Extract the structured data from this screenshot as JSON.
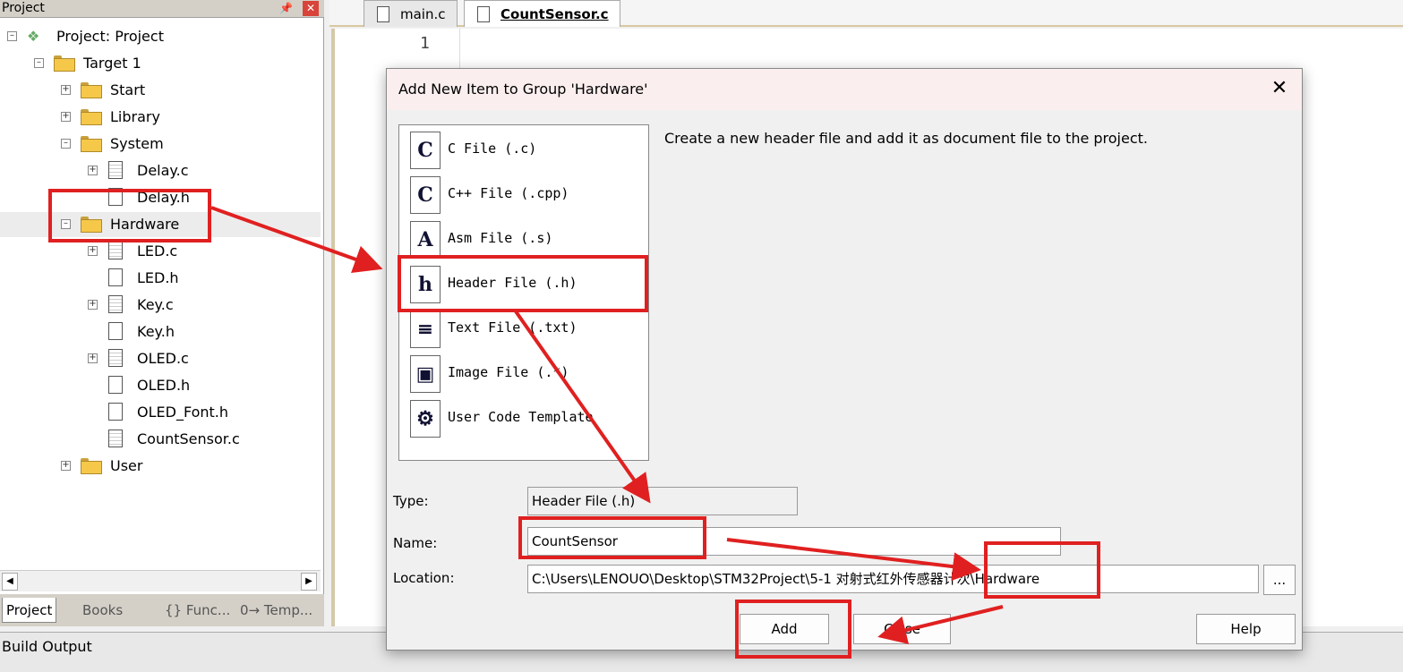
{
  "project_panel": {
    "title": "Project",
    "tree": [
      {
        "label": "Project: Project"
      },
      {
        "label": "Target 1"
      },
      {
        "label": "Start"
      },
      {
        "label": "Library"
      },
      {
        "label": "System"
      },
      {
        "label": "Delay.c"
      },
      {
        "label": "Delay.h"
      },
      {
        "label": "Hardware"
      },
      {
        "label": "LED.c"
      },
      {
        "label": "LED.h"
      },
      {
        "label": "Key.c"
      },
      {
        "label": "Key.h"
      },
      {
        "label": "OLED.c"
      },
      {
        "label": "OLED.h"
      },
      {
        "label": "OLED_Font.h"
      },
      {
        "label": "CountSensor.c"
      },
      {
        "label": "User"
      }
    ],
    "bottom_tabs": [
      "Project",
      "Books",
      "{} Func...",
      "0→ Temp..."
    ]
  },
  "editor": {
    "tabs": [
      "main.c",
      "CountSensor.c"
    ],
    "line_number": "1"
  },
  "build_output": {
    "title": "Build Output"
  },
  "dialog": {
    "title": "Add New Item to Group 'Hardware'",
    "close_glyph": "✕",
    "types": [
      {
        "icon": "C",
        "label": "C File (.c)"
      },
      {
        "icon": "C",
        "label": "C++ File (.cpp)"
      },
      {
        "icon": "A",
        "label": "Asm File (.s)"
      },
      {
        "icon": "h",
        "label": "Header File (.h)"
      },
      {
        "icon": "≡",
        "label": "Text File (.txt)"
      },
      {
        "icon": "▣",
        "label": "Image File (.*)"
      },
      {
        "icon": "⚙",
        "label": "User Code Template"
      }
    ],
    "description": "Create a new header file and add it as document file to the project.",
    "type_label": "Type:",
    "type_value": "Header File (.h)",
    "name_label": "Name:",
    "name_value": "CountSensor",
    "location_label": "Location:",
    "location_value": "C:\\Users\\LENOUO\\Desktop\\STM32Project\\5-1 对射式红外传感器计次\\Hardware",
    "browse_label": "...",
    "add_label": "Add",
    "close_label": "Close",
    "help_label": "Help"
  },
  "colors": {
    "annotation_red": "#e02020",
    "dialog_title_bg": "#fbeeee"
  }
}
